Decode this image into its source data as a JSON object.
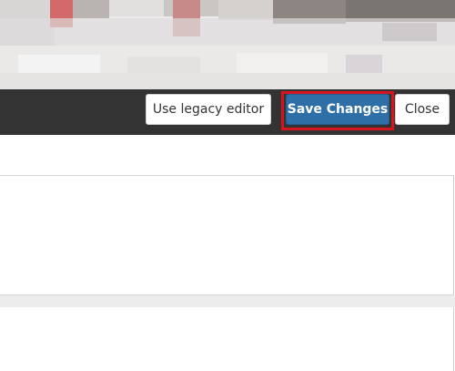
{
  "toolbar": {
    "legacy_label": "Use legacy editor",
    "save_label": "Save Changes",
    "close_label": "Close"
  },
  "colors": {
    "toolbar_bg": "#333333",
    "primary": "#2f6fa8",
    "highlight": "#d8141e"
  }
}
